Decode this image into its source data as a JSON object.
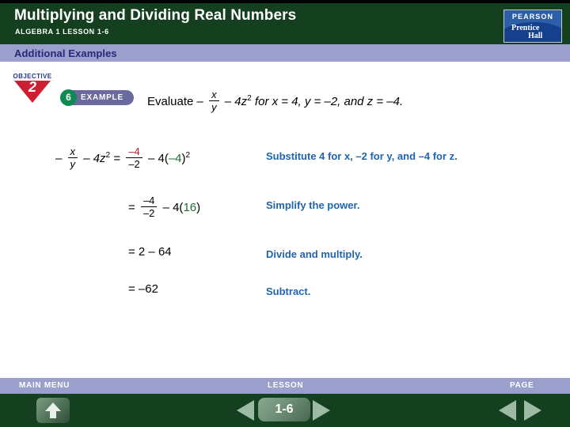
{
  "header": {
    "title": "Multiplying and Dividing Real Numbers",
    "subtitle": "ALGEBRA 1  LESSON 1-6",
    "logo": {
      "top": "PEARSON",
      "brand_line1": "Prentice",
      "brand_line2": "Hall"
    }
  },
  "subbar": {
    "label": "Additional Examples"
  },
  "objective": {
    "label": "OBJECTIVE",
    "number": "2"
  },
  "example": {
    "number": "6",
    "label": "EXAMPLE"
  },
  "problem": {
    "lead": "Evaluate",
    "minus": "–",
    "frac_num": "x",
    "frac_den": "y",
    "term": "– 4z",
    "exponent": "2",
    "conditions": " for x = 4, y = –2, and z = –4."
  },
  "steps": [
    {
      "math_plain": "– x/y – 4z² = –4/–2 – 4(–4)²",
      "lhs_minus": "–",
      "lhs_num": "x",
      "lhs_den": "y",
      "lhs_term": "– 4z",
      "lhs_exp": "2",
      "equals": "=",
      "rhs_num": "–4",
      "rhs_den": "–2",
      "rhs_tail_open": "– 4(",
      "rhs_tail_val": "–4",
      "rhs_tail_close": ")",
      "rhs_tail_exp": "2",
      "note": "Substitute 4 for x, –2 for y, and –4 for z."
    },
    {
      "math_plain": "= –4/–2 – 4(16)",
      "equals": "=",
      "rhs_num": "–4",
      "rhs_den": "–2",
      "rhs_tail_open": "– 4(",
      "rhs_tail_val": "16",
      "rhs_tail_close": ")",
      "note": "Simplify the power."
    },
    {
      "math_plain": "= 2 – 64",
      "note": "Divide and multiply."
    },
    {
      "math_plain": "= –62",
      "note": "Subtract."
    }
  ],
  "footer": {
    "main_menu": "MAIN MENU",
    "lesson": "LESSON",
    "page": "PAGE",
    "lesson_number": "1-6"
  },
  "colors": {
    "header_green": "#14401f",
    "bar_purple": "#9a9fcc",
    "note_blue": "#1f64ad",
    "highlight_red": "#c0192b",
    "highlight_green": "#1a6b34",
    "objective_red": "#cc1f33",
    "example_green": "#0f8a52"
  }
}
